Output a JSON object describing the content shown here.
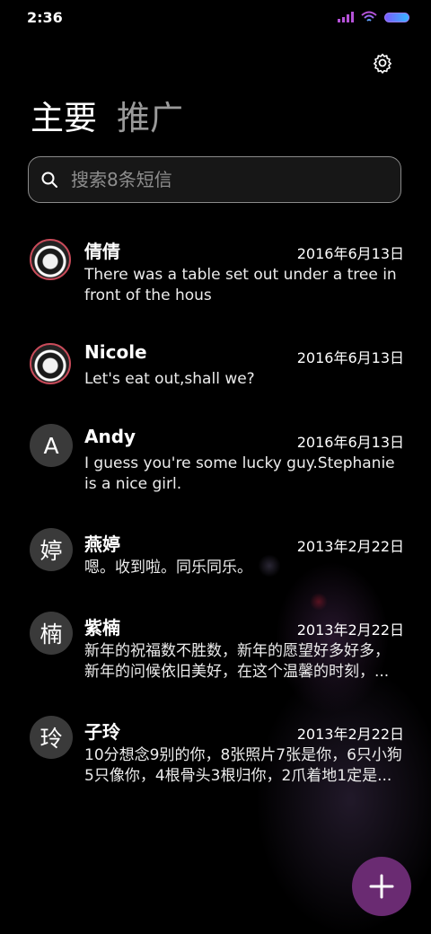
{
  "status_bar": {
    "time": "2:36"
  },
  "tabs": [
    {
      "label": "主要",
      "active": true
    },
    {
      "label": "推广",
      "active": false
    }
  ],
  "search": {
    "placeholder": "搜索8条短信"
  },
  "messages": [
    {
      "name": "倩倩",
      "date": "2016年6月13日",
      "preview": "There was a table set out under a tree in front of the hous",
      "avatar": "image"
    },
    {
      "name": "Nicole",
      "date": "2016年6月13日",
      "preview": "Let's eat out,shall we?",
      "avatar": "image"
    },
    {
      "name": "Andy",
      "date": "2016年6月13日",
      "preview": "I guess you're some lucky guy.Stephanie is a nice girl.",
      "avatar_text": "A"
    },
    {
      "name": "燕婷",
      "date": "2013年2月22日",
      "preview": "嗯。收到啦。同乐同乐。",
      "avatar_text": "婷"
    },
    {
      "name": "紫楠",
      "date": "2013年2月22日",
      "preview": "新年的祝福数不胜数，新年的愿望好多好多，新年的问候依旧美好，在这个温馨的时刻，...",
      "avatar_text": "楠"
    },
    {
      "name": "子玲",
      "date": "2013年2月22日",
      "preview": "10分想念9别的你，8张照片7张是你，6只小狗5只像你，4根骨头3根归你，2爪着地1定是...",
      "avatar_text": "玲"
    }
  ],
  "icons": {
    "settings": "gear-icon",
    "search": "search-icon",
    "compose": "plus-icon"
  },
  "colors": {
    "background": "#000000",
    "fab": "#6a2b72",
    "avatar_bg": "#3a3a3a"
  }
}
